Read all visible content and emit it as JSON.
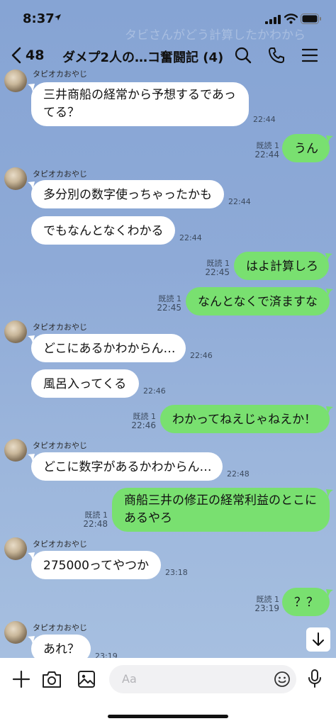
{
  "status_bar": {
    "time": "8:37"
  },
  "ghost_text": "タビさんがどう計算したかわから",
  "header": {
    "back_count": "48",
    "title": "ダメプ2人の…コ奮闘記 (4)"
  },
  "messages": [
    {
      "dir": "in",
      "sender": "タピオカおやじ",
      "text": [
        "三井商船の経常から予想するであっ",
        "てる？"
      ],
      "time": "22:44"
    },
    {
      "dir": "out",
      "read": "既読 1",
      "text": [
        "うん"
      ],
      "time": "22:44"
    },
    {
      "dir": "in",
      "sender": "タピオカおやじ",
      "text": [
        "多分別の数字使っちゃったかも"
      ],
      "time": "22:44"
    },
    {
      "dir": "in",
      "text": [
        "でもなんとなくわかる"
      ],
      "time": "22:44"
    },
    {
      "dir": "out",
      "read": "既読 1",
      "text": [
        "はよ計算しろ"
      ],
      "time": "22:45"
    },
    {
      "dir": "out",
      "read": "既読 1",
      "text": [
        "なんとなくで済ますな"
      ],
      "time": "22:45"
    },
    {
      "dir": "in",
      "sender": "タピオカおやじ",
      "text": [
        "どこにあるかわからん…"
      ],
      "time": "22:46"
    },
    {
      "dir": "in",
      "text": [
        "風呂入ってくる"
      ],
      "time": "22:46"
    },
    {
      "dir": "out",
      "read": "既読 1",
      "text": [
        "わかってねえじゃねえか！"
      ],
      "time": "22:46"
    },
    {
      "dir": "in",
      "sender": "タピオカおやじ",
      "text": [
        "どこに数字があるかわからん…"
      ],
      "time": "22:48"
    },
    {
      "dir": "out",
      "read": "既読 1",
      "text": [
        "商船三井の修正の経常利益のとこに",
        "あるやろ"
      ],
      "time": "22:48"
    },
    {
      "dir": "in",
      "sender": "タピオカおやじ",
      "text": [
        "275000ってやつか"
      ],
      "time": "23:18"
    },
    {
      "dir": "out",
      "read": "既読 1",
      "text": [
        "？？"
      ],
      "time": "23:19"
    },
    {
      "dir": "in",
      "sender": "タピオカおやじ",
      "text": [
        "あれ？"
      ],
      "time": "23:19"
    }
  ],
  "composer": {
    "placeholder": "Aa"
  },
  "icons": {
    "back": "chevron-left-icon",
    "search": "search-icon",
    "call": "phone-icon",
    "menu": "menu-icon",
    "scroll": "arrow-down-icon",
    "plus": "plus-icon",
    "camera": "camera-icon",
    "image": "image-icon",
    "emoji": "emoji-icon",
    "mic": "mic-icon"
  },
  "colors": {
    "background": "#8fabd6",
    "bubble_in": "#ffffff",
    "bubble_out": "#79e070"
  }
}
